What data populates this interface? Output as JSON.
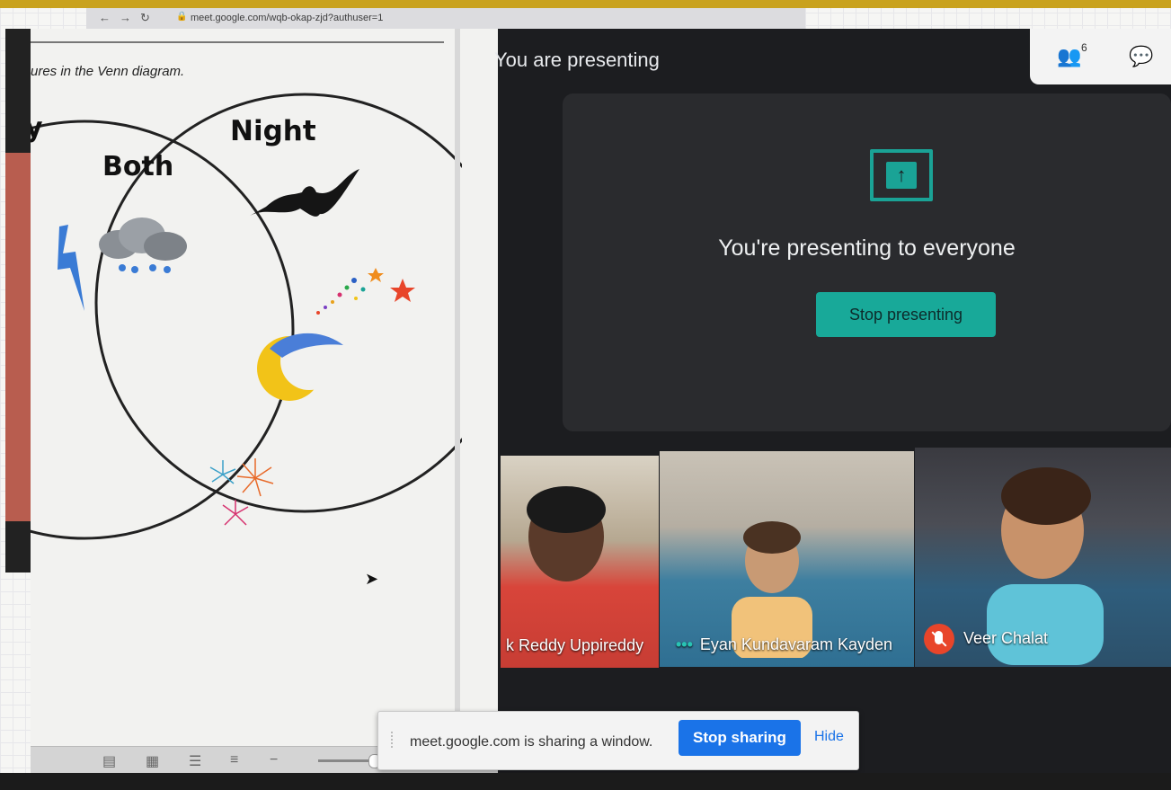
{
  "browser": {
    "url": "meet.google.com/wqb-okap-zjd?authuser=1"
  },
  "document": {
    "instruction": "ures in the Venn diagram.",
    "venn_labels": {
      "left": "y",
      "both": "Both",
      "right": "Night"
    }
  },
  "meet": {
    "header": "You are presenting",
    "participant_count": "6",
    "present_message": "You're presenting to everyone",
    "stop_presenting_label": "Stop presenting",
    "participants": [
      {
        "name": "k Reddy Uppireddy",
        "status": "none"
      },
      {
        "name": "Eyan Kundavaram Kayden",
        "status": "speaking"
      },
      {
        "name": "Veer Chalat",
        "status": "muted"
      }
    ]
  },
  "sharing_bar": {
    "message": "meet.google.com is sharing a window.",
    "stop_sharing_label": "Stop sharing",
    "hide_label": "Hide"
  },
  "colors": {
    "meet_accent": "#1aa396",
    "share_button": "#1a73e8",
    "muted_red": "#e8452a"
  },
  "icons": [
    "back-icon",
    "forward-icon",
    "reload-icon",
    "lock-icon",
    "people-icon",
    "chat-icon",
    "present-screen-icon",
    "mic-off-icon",
    "cursor-arrow-icon"
  ]
}
